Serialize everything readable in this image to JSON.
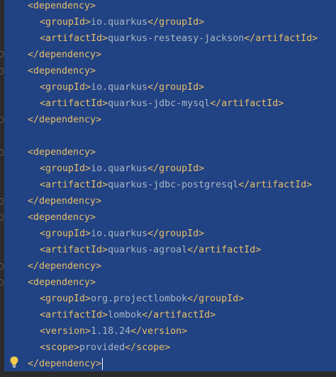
{
  "editor": {
    "lines": [
      {
        "open": "<dependency>",
        "text": "",
        "close": ""
      },
      {
        "open": "<groupId>",
        "text": "io.quarkus",
        "close": "</groupId>"
      },
      {
        "open": "<artifactId>",
        "text": "quarkus-resteasy-jackson",
        "close": "</artifactId>"
      },
      {
        "open": "</dependency>",
        "text": "",
        "close": ""
      },
      {
        "open": "<dependency>",
        "text": "",
        "close": ""
      },
      {
        "open": "<groupId>",
        "text": "io.quarkus",
        "close": "</groupId>"
      },
      {
        "open": "<artifactId>",
        "text": "quarkus-jdbc-mysql",
        "close": "</artifactId>"
      },
      {
        "open": "</dependency>",
        "text": "",
        "close": ""
      },
      {
        "open": "",
        "text": "",
        "close": ""
      },
      {
        "open": "<dependency>",
        "text": "",
        "close": ""
      },
      {
        "open": "<groupId>",
        "text": "io.quarkus",
        "close": "</groupId>"
      },
      {
        "open": "<artifactId>",
        "text": "quarkus-jdbc-postgresql",
        "close": "</artifactId>"
      },
      {
        "open": "</dependency>",
        "text": "",
        "close": ""
      },
      {
        "open": "<dependency>",
        "text": "",
        "close": ""
      },
      {
        "open": "<groupId>",
        "text": "io.quarkus",
        "close": "</groupId>"
      },
      {
        "open": "<artifactId>",
        "text": "quarkus-agroal",
        "close": "</artifactId>"
      },
      {
        "open": "</dependency>",
        "text": "",
        "close": ""
      },
      {
        "open": "<dependency>",
        "text": "",
        "close": ""
      },
      {
        "open": "<groupId>",
        "text": "org.projectlombok",
        "close": "</groupId>"
      },
      {
        "open": "<artifactId>",
        "text": "lombok",
        "close": "</artifactId>"
      },
      {
        "open": "<version>",
        "text": "1.18.24",
        "close": "</version>"
      },
      {
        "open": "<scope>",
        "text": "provided",
        "close": "</scope>"
      },
      {
        "open": "</dependency>",
        "text": "",
        "close": ""
      }
    ]
  },
  "colors": {
    "selection": "#214283",
    "tag": "#e8bf6a",
    "text": "#a9b7c6",
    "background": "#2b2b2b"
  },
  "icons": {
    "intention_bulb": "lightbulb-icon",
    "fold": "fold-marker-icon"
  }
}
